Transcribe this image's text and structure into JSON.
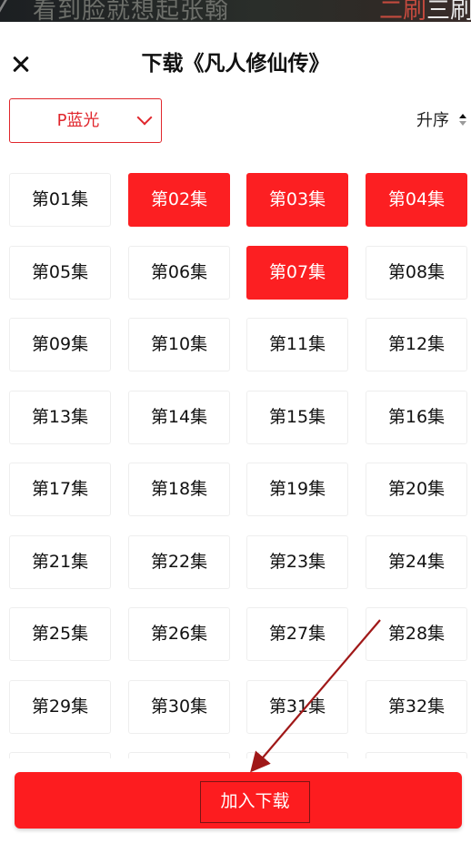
{
  "video_strip": {
    "subtitle": "看到脸就想起张翰",
    "overlay_red": "二刷",
    "overlay_white": "三刷"
  },
  "header": {
    "title": "下载《凡人修仙传》"
  },
  "filters": {
    "quality_selected": "P蓝光",
    "sort_label": "升序"
  },
  "episodes": [
    {
      "label": "第01集",
      "selected": false
    },
    {
      "label": "第02集",
      "selected": true
    },
    {
      "label": "第03集",
      "selected": true
    },
    {
      "label": "第04集",
      "selected": true
    },
    {
      "label": "第05集",
      "selected": false
    },
    {
      "label": "第06集",
      "selected": false
    },
    {
      "label": "第07集",
      "selected": true
    },
    {
      "label": "第08集",
      "selected": false
    },
    {
      "label": "第09集",
      "selected": false
    },
    {
      "label": "第10集",
      "selected": false
    },
    {
      "label": "第11集",
      "selected": false
    },
    {
      "label": "第12集",
      "selected": false
    },
    {
      "label": "第13集",
      "selected": false
    },
    {
      "label": "第14集",
      "selected": false
    },
    {
      "label": "第15集",
      "selected": false
    },
    {
      "label": "第16集",
      "selected": false
    },
    {
      "label": "第17集",
      "selected": false
    },
    {
      "label": "第18集",
      "selected": false
    },
    {
      "label": "第19集",
      "selected": false
    },
    {
      "label": "第20集",
      "selected": false
    },
    {
      "label": "第21集",
      "selected": false
    },
    {
      "label": "第22集",
      "selected": false
    },
    {
      "label": "第23集",
      "selected": false
    },
    {
      "label": "第24集",
      "selected": false
    },
    {
      "label": "第25集",
      "selected": false
    },
    {
      "label": "第26集",
      "selected": false
    },
    {
      "label": "第27集",
      "selected": false
    },
    {
      "label": "第28集",
      "selected": false
    },
    {
      "label": "第29集",
      "selected": false
    },
    {
      "label": "第30集",
      "selected": false
    },
    {
      "label": "第31集",
      "selected": false
    },
    {
      "label": "第32集",
      "selected": false
    },
    {
      "label": "",
      "selected": false
    },
    {
      "label": "",
      "selected": false
    },
    {
      "label": "",
      "selected": false
    },
    {
      "label": "",
      "selected": false
    }
  ],
  "footer": {
    "download_label": "加入下载"
  },
  "colors": {
    "accent": "#fc1f22",
    "annotation": "#a01818"
  },
  "icons": {
    "close": "close-icon",
    "dropdown": "chevron-down-icon",
    "sort": "sort-arrows-icon"
  }
}
